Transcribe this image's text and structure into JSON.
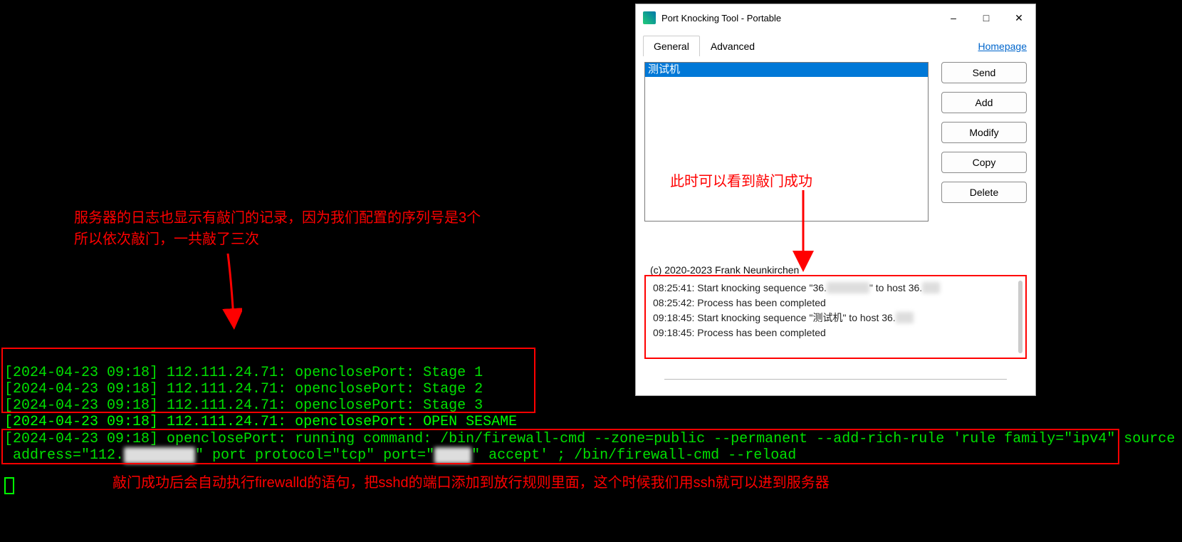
{
  "annotations": {
    "server_log_note_line1": "服务器的日志也显示有敲门的记录，因为我们配置的序列号是3个",
    "server_log_note_line2": "所以依次敲门，一共敲了三次",
    "knock_ok": "此时可以看到敲门成功",
    "success_note": "敲门成功后会自动执行firewalld的语句，把sshd的端口添加到放行规则里面，这个时候我们用ssh就可以进到服务器"
  },
  "terminal": {
    "lines": [
      "[2024-04-23 09:18] 112.111.24.71: openclosePort: Stage 1",
      "[2024-04-23 09:18] 112.111.24.71: openclosePort: Stage 2",
      "[2024-04-23 09:18] 112.111.24.71: openclosePort: Stage 3",
      "[2024-04-23 09:18] 112.111.24.71: openclosePort: OPEN SESAME"
    ],
    "cmd_line1": "[2024-04-23 09:18] openclosePort: running command: /bin/firewall-cmd --zone=public --permanent --add-rich-rule 'rule family=\"ipv4\" source",
    "cmd_line2_a": " address=\"112.",
    "cmd_line2_b": "\" port protocol=\"tcp\" port=\"",
    "cmd_line2_c": "\" accept' ; /bin/firewall-cmd --reload"
  },
  "dialog": {
    "title": "Port Knocking Tool - Portable",
    "tabs": {
      "general": "General",
      "advanced": "Advanced"
    },
    "homepage": "Homepage",
    "list_item": "测试机",
    "buttons": {
      "send": "Send",
      "add": "Add",
      "modify": "Modify",
      "copy": "Copy",
      "delete": "Delete"
    },
    "copyright": "(c) 2020-2023 Frank Neunkirchen",
    "log": {
      "l1a": "08:25:41: Start knocking sequence \"36.",
      "l1b": "\" to host 36.",
      "l2": "08:25:42: Process has been completed",
      "l3a": "09:18:45: Start knocking sequence \"测试机\" to host 36.",
      "l4": "09:18:45: Process has been completed"
    }
  }
}
